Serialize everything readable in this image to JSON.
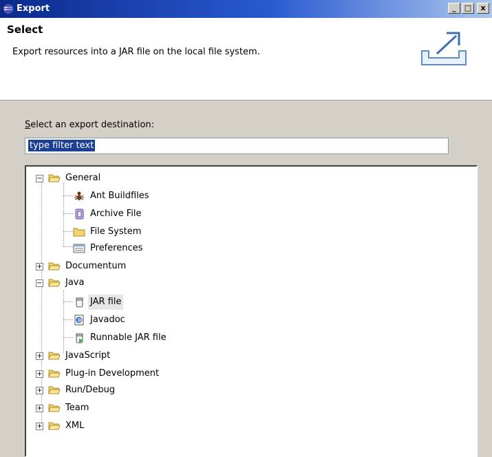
{
  "window": {
    "title": "Export",
    "buttons": {
      "minimize": "_",
      "maximize": "□",
      "close": "x"
    }
  },
  "header": {
    "title": "Select",
    "description": "Export resources into a JAR file on the local file system."
  },
  "destination": {
    "label_first": "S",
    "label_rest": "elect an export destination:",
    "filter_value": "type filter text"
  },
  "tree": {
    "general": "General",
    "ant_buildfiles": "Ant Buildfiles",
    "archive_file": "Archive File",
    "file_system": "File System",
    "preferences": "Preferences",
    "documentum": "Documentum",
    "java": "Java",
    "jar_file": "JAR file",
    "javadoc": "Javadoc",
    "runnable_jar": "Runnable JAR file",
    "javascript": "JavaScript",
    "plugin_dev": "Plug-in Development",
    "run_debug": "Run/Debug",
    "team": "Team",
    "xml": "XML"
  },
  "colors": {
    "titlebar_start": "#0a2a8c",
    "selection": "#1c3e93",
    "folder": "#f5d36b"
  }
}
